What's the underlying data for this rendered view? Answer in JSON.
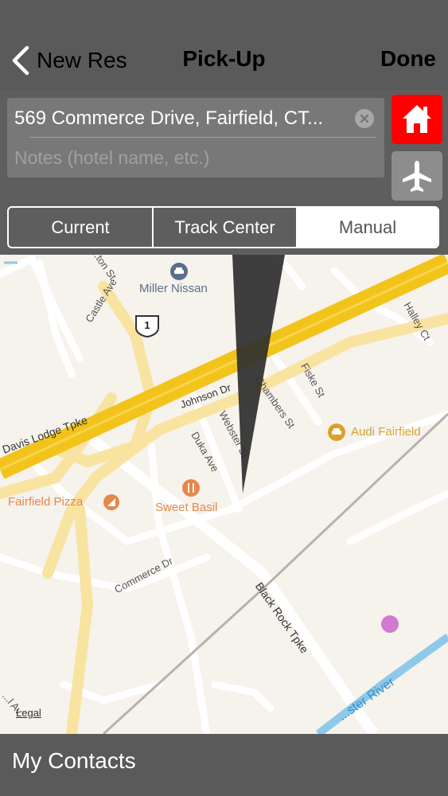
{
  "nav": {
    "back_label": "New Res",
    "title": "Pick-Up",
    "done_label": "Done"
  },
  "address": {
    "value": "569 Commerce Drive, Fairfield, CT...",
    "notes_placeholder": "Notes (hotel name, etc.)"
  },
  "buttons": {
    "home_icon": "home-icon",
    "airport_icon": "airplane-icon"
  },
  "segments": [
    "Current",
    "Track Center",
    "Manual"
  ],
  "selected_segment": "Manual",
  "map": {
    "streets": [
      "Castle Ave",
      "Davis Lodge Tpke",
      "Johnson Dr",
      "Chambers St",
      "Webster St",
      "Fiske St",
      "Halley Ct",
      "Duka Ave",
      "Commerce Dr",
      "Black Rock Tpke",
      "...ton St"
    ],
    "water_label": "...ster River",
    "route_shield": "1",
    "pois": [
      {
        "name": "Miller Nissan",
        "color": "#5b6f8a"
      },
      {
        "name": "Audi Fairfield",
        "color": "#d9a12b"
      },
      {
        "name": "Fairfield Pizza",
        "color": "#e6884a"
      },
      {
        "name": "Sweet Basil",
        "color": "#e6884a"
      }
    ],
    "legal": "Legal",
    "edge_label": "...l Av"
  },
  "bottom": {
    "contacts_label": "My Contacts"
  },
  "colors": {
    "home_bg": "#ff0000",
    "highway": "#f5c518"
  }
}
